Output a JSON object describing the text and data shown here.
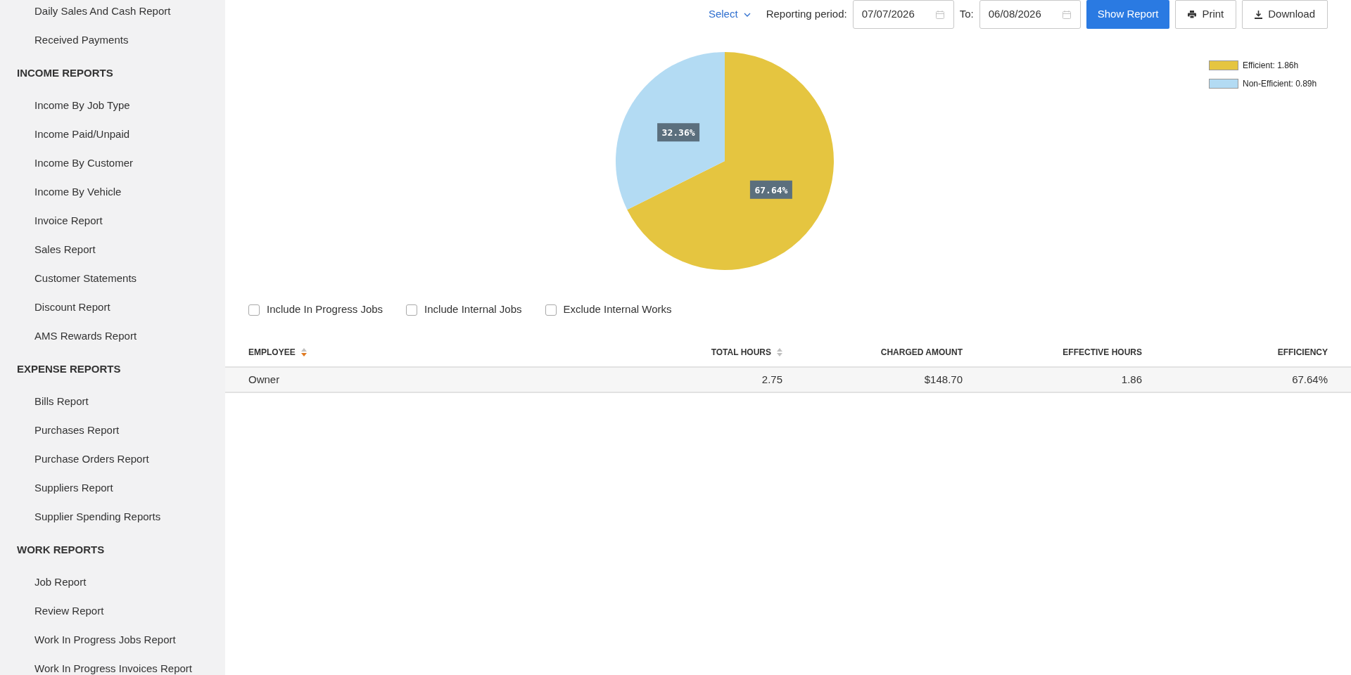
{
  "sidebar": {
    "sections": [
      {
        "items": [
          "Daily Sales And Cash Report",
          "Received Payments"
        ]
      },
      {
        "heading": "INCOME REPORTS",
        "items": [
          "Income By Job Type",
          "Income Paid/Unpaid",
          "Income By Customer",
          "Income By Vehicle",
          "Invoice Report",
          "Sales Report",
          "Customer Statements",
          "Discount Report",
          "AMS Rewards Report"
        ]
      },
      {
        "heading": "EXPENSE REPORTS",
        "items": [
          "Bills Report",
          "Purchases Report",
          "Purchase Orders Report",
          "Suppliers Report",
          "Supplier Spending Reports"
        ]
      },
      {
        "heading": "WORK REPORTS",
        "items": [
          "Job Report",
          "Review Report",
          "Work In Progress Jobs Report",
          "Work In Progress Invoices Report"
        ]
      }
    ]
  },
  "toolbar": {
    "select": "Select",
    "period_label": "Reporting period:",
    "from_date": "07/07/2026",
    "to_label": "To:",
    "to_date": "06/08/2026",
    "buttons": [
      {
        "kind": "primary",
        "label": "Show Report"
      },
      {
        "kind": "print",
        "label": "Print"
      },
      {
        "kind": "download",
        "label": "Download"
      }
    ]
  },
  "chart": {
    "chart_data": {
      "type": "pie",
      "categories": [
        "Efficient: 1.86h",
        "Non-Efficient: 0.89h"
      ],
      "values": [
        67.64,
        32.36
      ],
      "colors": [
        "#e5c540",
        "#b3dbf3"
      ],
      "value_labels": [
        "67.64%",
        "32.36%"
      ]
    }
  },
  "options": [
    {
      "label": "Include In Progress Jobs",
      "checked": false
    },
    {
      "label": "Include Internal Jobs",
      "checked": false
    },
    {
      "label": "Exclude Internal Works",
      "checked": false
    }
  ],
  "table": {
    "columns": [
      {
        "label": "EMPLOYEE",
        "sortable": true,
        "sorted": true
      },
      {
        "label": "TOTAL HOURS",
        "sortable": true,
        "sorted": false
      },
      {
        "label": "CHARGED AMOUNT"
      },
      {
        "label": "EFFECTIVE HOURS"
      },
      {
        "label": "EFFICIENCY"
      }
    ],
    "rows": [
      [
        "Owner",
        "2.75",
        "$148.70",
        "1.86",
        "67.64%"
      ]
    ]
  }
}
